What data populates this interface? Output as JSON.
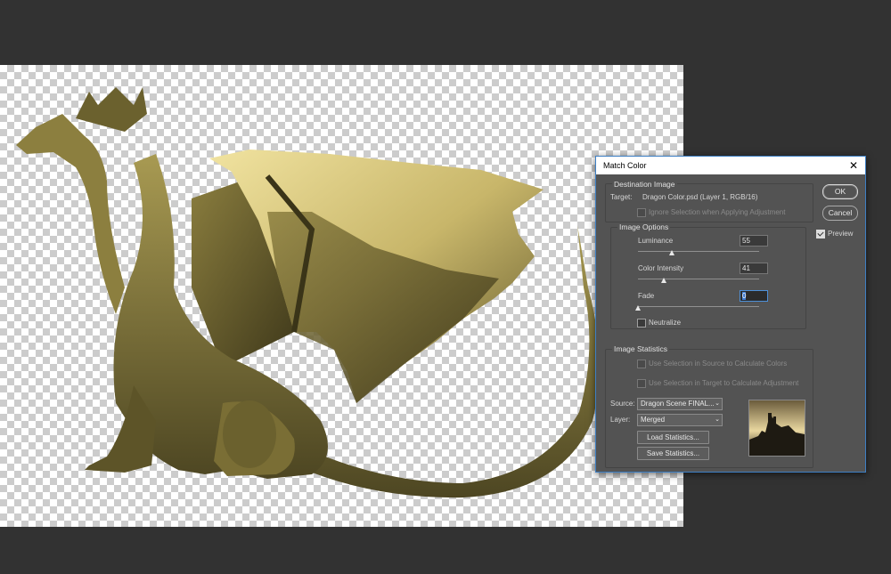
{
  "dialog": {
    "title": "Match Color",
    "destination": {
      "header": "Destination Image",
      "target_label": "Target:",
      "target_value": "Dragon Color.psd (Layer 1, RGB/16)",
      "ignore_selection": "Ignore Selection when Applying Adjustment"
    },
    "image_options": {
      "header": "Image Options",
      "luminance_label": "Luminance",
      "luminance_value": "55",
      "color_intensity_label": "Color Intensity",
      "color_intensity_value": "41",
      "fade_label": "Fade",
      "fade_value": "0",
      "neutralize_label": "Neutralize"
    },
    "image_statistics": {
      "header": "Image Statistics",
      "use_sel_source": "Use Selection in Source to Calculate Colors",
      "use_sel_target": "Use Selection in Target to Calculate Adjustment",
      "source_label": "Source:",
      "source_value": "Dragon Scene FINAL...",
      "layer_label": "Layer:",
      "layer_value": "Merged",
      "load_button": "Load Statistics...",
      "save_button": "Save Statistics..."
    },
    "buttons": {
      "ok": "OK",
      "cancel": "Cancel",
      "preview_label": "Preview"
    }
  },
  "state": {
    "preview_checked": true,
    "neutralize_checked": false,
    "luminance_level": 55,
    "luminance_max": 200,
    "color_intensity_level": 41,
    "color_intensity_max": 200,
    "fade_level": 0,
    "fade_max": 100
  },
  "colors": {
    "app_background": "#323232",
    "dialog_background": "#535353",
    "dialog_border": "#3d7fc4",
    "dragon_tone": "#a89a52"
  },
  "icons": {
    "close": "close-icon",
    "dropdown": "chevron-down-icon"
  }
}
